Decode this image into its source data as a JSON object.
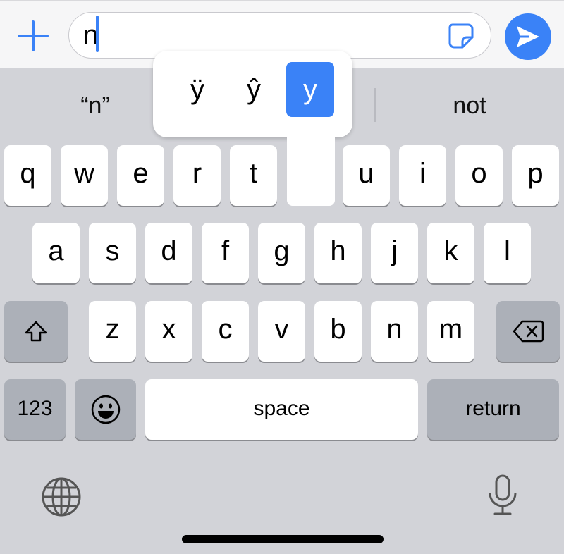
{
  "message_field": {
    "text": "n"
  },
  "predictions": {
    "left": "“n”",
    "right": "not"
  },
  "accent_popup": {
    "options": [
      "ÿ",
      "ŷ",
      "y"
    ],
    "selected": "y"
  },
  "keyboard": {
    "row1": [
      "q",
      "w",
      "e",
      "r",
      "t",
      "y",
      "u",
      "i",
      "o",
      "p"
    ],
    "row2": [
      "a",
      "s",
      "d",
      "f",
      "g",
      "h",
      "j",
      "k",
      "l"
    ],
    "row3": [
      "z",
      "x",
      "c",
      "v",
      "b",
      "n",
      "m"
    ],
    "numbers_label": "123",
    "space_label": "space",
    "return_label": "return"
  },
  "icons": [
    "plus-icon",
    "sticker-icon",
    "send-arrow-icon",
    "shift-icon",
    "delete-icon",
    "emoji-icon",
    "globe-icon",
    "microphone-icon"
  ],
  "colors": {
    "accent": "#3a82f7",
    "keyboard_bg": "#d2d3d8",
    "dark_key": "#acb0b8"
  }
}
